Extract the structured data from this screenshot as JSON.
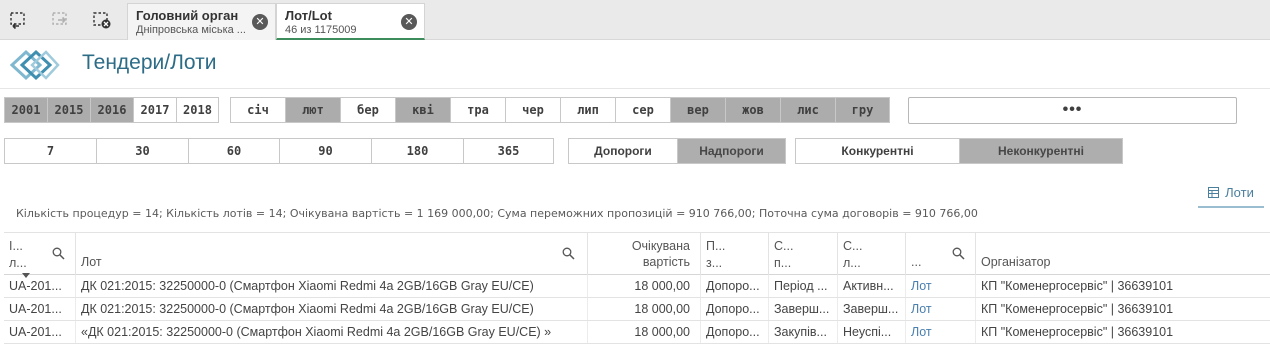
{
  "toolbar": {
    "icons": [
      "smart-search-icon",
      "step-forward-icon",
      "clear-selections-icon"
    ]
  },
  "tabs": [
    {
      "title": "Головний орган",
      "subtitle": "Дніпровська міська ...",
      "close_icon": "close-icon"
    },
    {
      "title": "Лот/Lot",
      "subtitle": "46 из 1175009",
      "close_icon": "close-icon"
    }
  ],
  "header": {
    "title": "Тендери/Лоти",
    "logo_icon": "prozorro-logo-icon"
  },
  "filters": {
    "years": [
      {
        "label": "2001",
        "state": "excluded"
      },
      {
        "label": "2015",
        "state": "excluded"
      },
      {
        "label": "2016",
        "state": "excluded"
      },
      {
        "label": "2017",
        "state": "possible"
      },
      {
        "label": "2018",
        "state": "possible"
      }
    ],
    "months": [
      {
        "label": "січ",
        "state": "possible"
      },
      {
        "label": "лют",
        "state": "excluded"
      },
      {
        "label": "бер",
        "state": "possible"
      },
      {
        "label": "кві",
        "state": "excluded"
      },
      {
        "label": "тра",
        "state": "possible"
      },
      {
        "label": "чер",
        "state": "possible"
      },
      {
        "label": "лип",
        "state": "possible"
      },
      {
        "label": "сер",
        "state": "possible"
      },
      {
        "label": "вер",
        "state": "excluded"
      },
      {
        "label": "жов",
        "state": "excluded"
      },
      {
        "label": "лис",
        "state": "excluded"
      },
      {
        "label": "гру",
        "state": "excluded"
      }
    ],
    "more_label": "•••",
    "days": [
      {
        "label": "7"
      },
      {
        "label": "30"
      },
      {
        "label": "60"
      },
      {
        "label": "90"
      },
      {
        "label": "180"
      },
      {
        "label": "365"
      }
    ],
    "threshold": [
      {
        "label": "Допороги",
        "state": "possible"
      },
      {
        "label": "Надпороги",
        "state": "excluded"
      }
    ],
    "competition": [
      {
        "label": "Конкурентні",
        "state": "possible"
      },
      {
        "label": "Неконкурентні",
        "state": "excluded"
      }
    ]
  },
  "lots_tab": {
    "label": "Лоти",
    "icon": "table-icon"
  },
  "summary": "Кількість процедур = 14; Кількість лотів = 14; Очікувана вартість = 1 169 000,00; Сума переможних пропозицій = 910 766,00; Поточна сума договорів = 910 766,00",
  "table": {
    "columns": [
      {
        "label": "І...\nл...",
        "search": true
      },
      {
        "label": "Лот",
        "search": true
      },
      {
        "label": "Очікувана\nвартість",
        "search": false
      },
      {
        "label": "П...\nз...",
        "search": false
      },
      {
        "label": "С...\nп...",
        "search": false
      },
      {
        "label": "С...\nл...",
        "search": false
      },
      {
        "label": "...",
        "search": true
      },
      {
        "label": "Організатор",
        "search": false
      }
    ],
    "rows": [
      [
        "UA-201...",
        "ДК 021:2015: 32250000-0 (Смартфон Xiaomi Redmi 4a 2GB/16GB Gray EU/CE)",
        "18 000,00",
        "Допоро...",
        "Період ...",
        "Активн...",
        "Лот",
        "КП \"Коменергосервіс\" | 36639101"
      ],
      [
        "UA-201...",
        "ДК 021:2015: 32250000-0 (Смартфон Xiaomi Redmi 4a 2GB/16GB Gray EU/CE)",
        "18 000,00",
        "Допоро...",
        "Заверш...",
        "Заверш...",
        "Лот",
        "КП \"Коменергосервіс\" | 36639101"
      ],
      [
        "UA-201...",
        "«ДК 021:2015: 32250000-0 (Смартфон Xiaomi Redmi 4a 2GB/16GB Gray EU/CE) »",
        "18 000,00",
        "Допоро...",
        "Закупів...",
        "Неуспі...",
        "Лот",
        "КП \"Коменергосервіс\" | 36639101"
      ]
    ]
  },
  "colors": {
    "title": "#2d6c87",
    "excluded": "#acacac",
    "link": "#4a7fb0",
    "active_tab": "#3c8c5c"
  }
}
